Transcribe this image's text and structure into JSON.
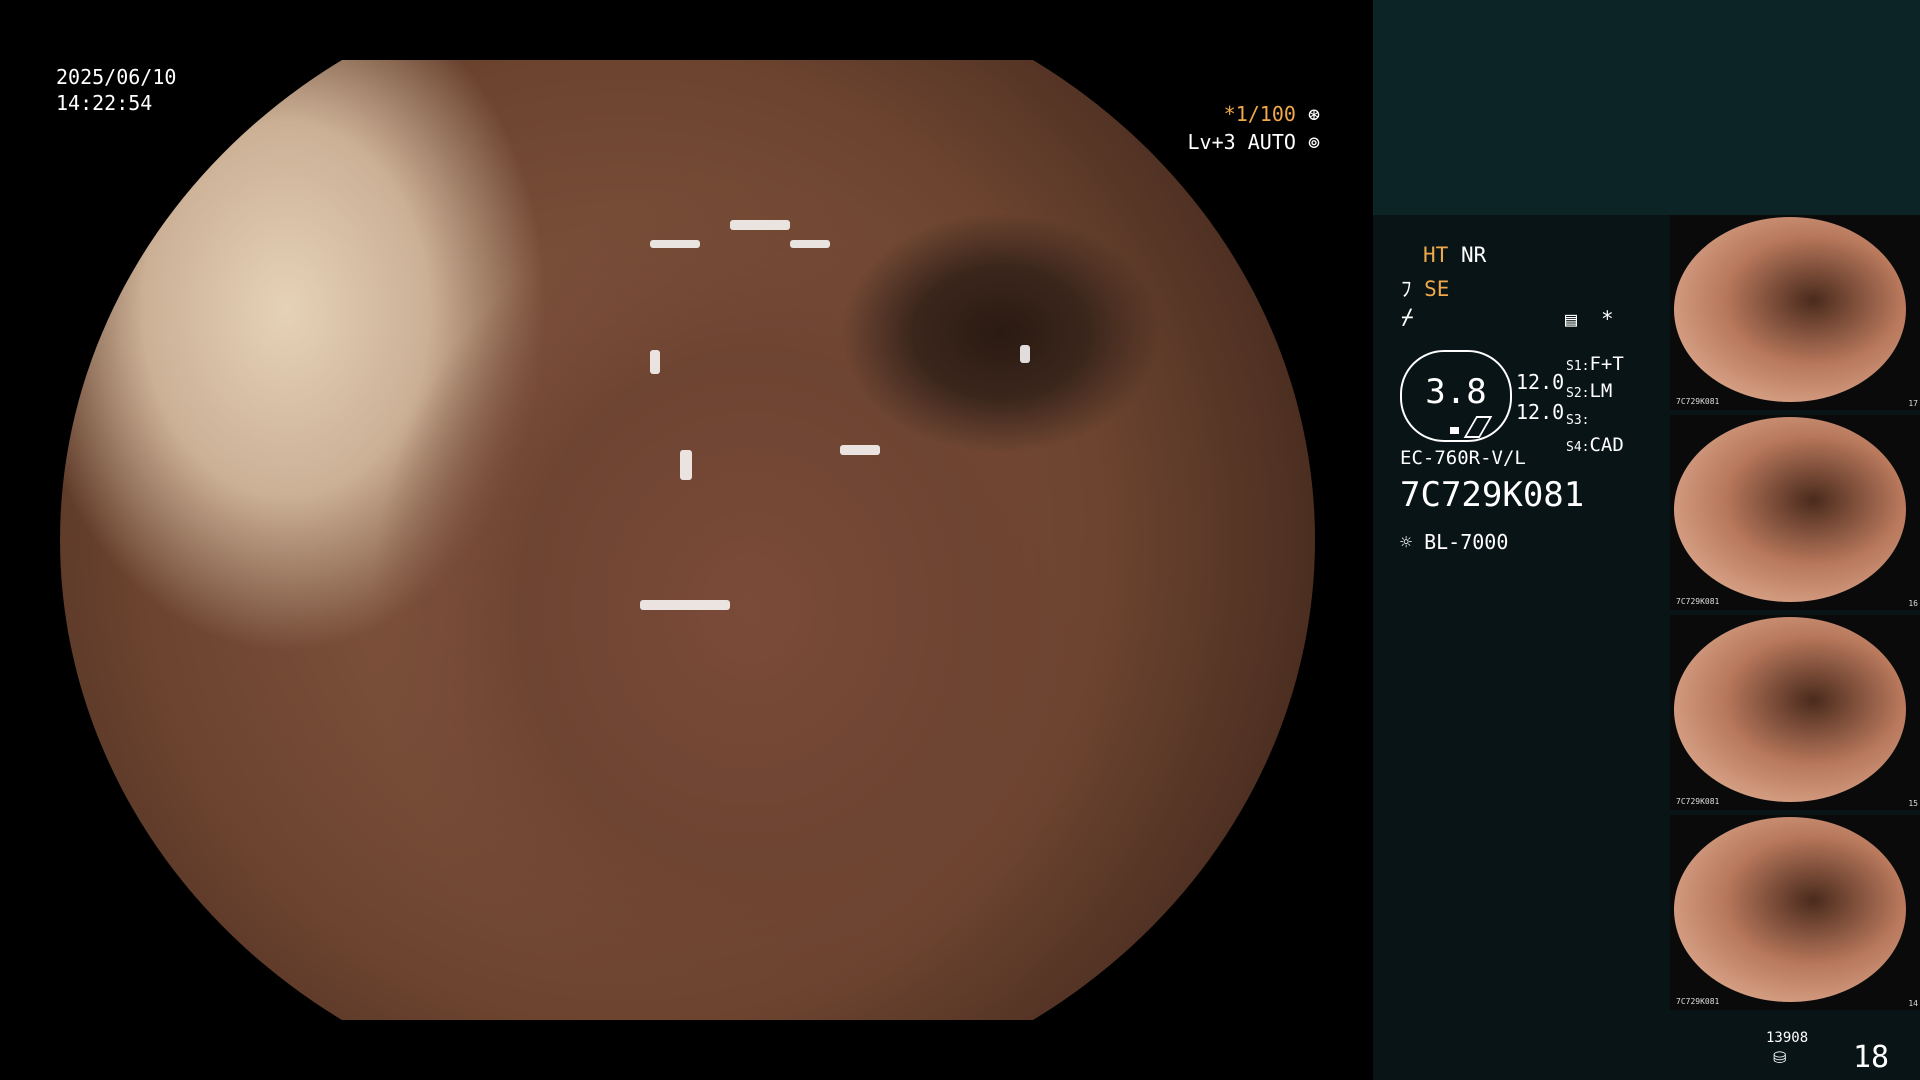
{
  "overlay": {
    "date": "2025/06/10",
    "time": "14:22:54",
    "shutter": "*1/100",
    "level": "Lv+3",
    "mode": "AUTO"
  },
  "info": {
    "ht": "HT",
    "nr": "NR",
    "se": "SE",
    "gauge_value": "3.8",
    "val1": "12.0",
    "val2": "12.0",
    "s1_label": "S1:",
    "s1_value": "F+T",
    "s2_label": "S2:",
    "s2_value": "LM",
    "s3_label": "S3:",
    "s3_value": "",
    "s4_label": "S4:",
    "s4_value": "CAD",
    "scope_model": "EC-760R-V/L",
    "serial": "7C729K081",
    "light_source": "BL-7000",
    "asterisk": "*"
  },
  "thumbnails": [
    {
      "id": "7C729K081",
      "num": "17"
    },
    {
      "id": "7C729K081",
      "num": "16"
    },
    {
      "id": "7C729K081",
      "num": "15"
    },
    {
      "id": "7C729K081",
      "num": "14"
    }
  ],
  "footer": {
    "storage_count": "13908",
    "image_count": "18"
  },
  "colors": {
    "accent_orange": "#f0a94a",
    "panel_bg": "#081415",
    "panel_top_bg": "#0d2426"
  }
}
